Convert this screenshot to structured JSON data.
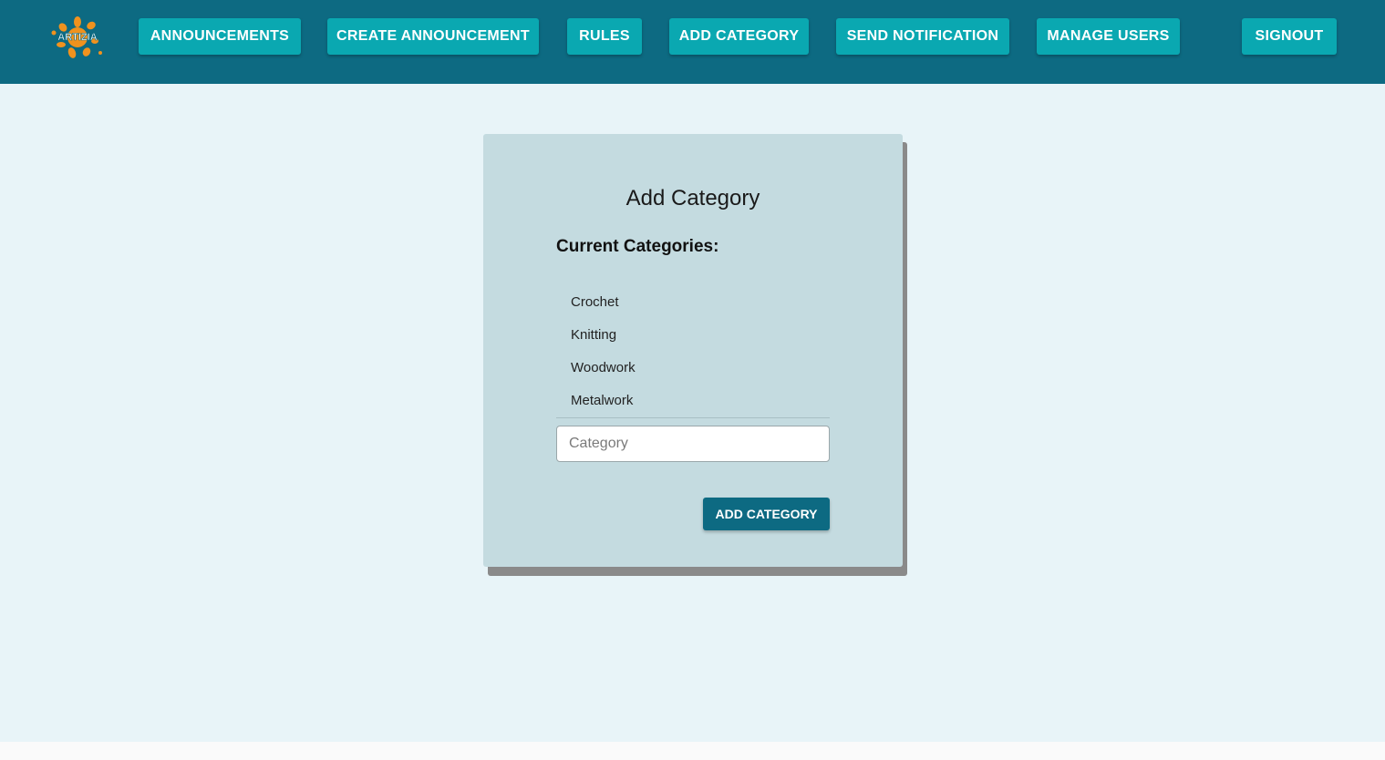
{
  "brand": {
    "logo_text": "ARTIZIA",
    "icon": "splash-flower-logo",
    "logo_color": "#f0921e"
  },
  "nav": {
    "announcements": "ANNOUNCEMENTS",
    "create_announcement": "CREATE ANNOUNCEMENT",
    "rules": "RULES",
    "add_category": "ADD CATEGORY",
    "send_notification": "SEND NOTIFICATION",
    "manage_users": "MANAGE USERS",
    "signout": "SIGNOUT"
  },
  "card": {
    "title": "Add Category",
    "current_heading": "Current Categories:",
    "categories": [
      "Crochet",
      "Knitting",
      "Woodwork",
      "Metalwork"
    ],
    "input_placeholder": "Category",
    "input_value": "",
    "submit_label": "ADD CATEGORY"
  },
  "colors": {
    "header_bg": "#0d6a82",
    "nav_button_bg": "#0aa8b1",
    "page_bg": "#e8f4f8",
    "card_bg": "#c4dbe0",
    "primary_button_bg": "#0d6a82"
  }
}
